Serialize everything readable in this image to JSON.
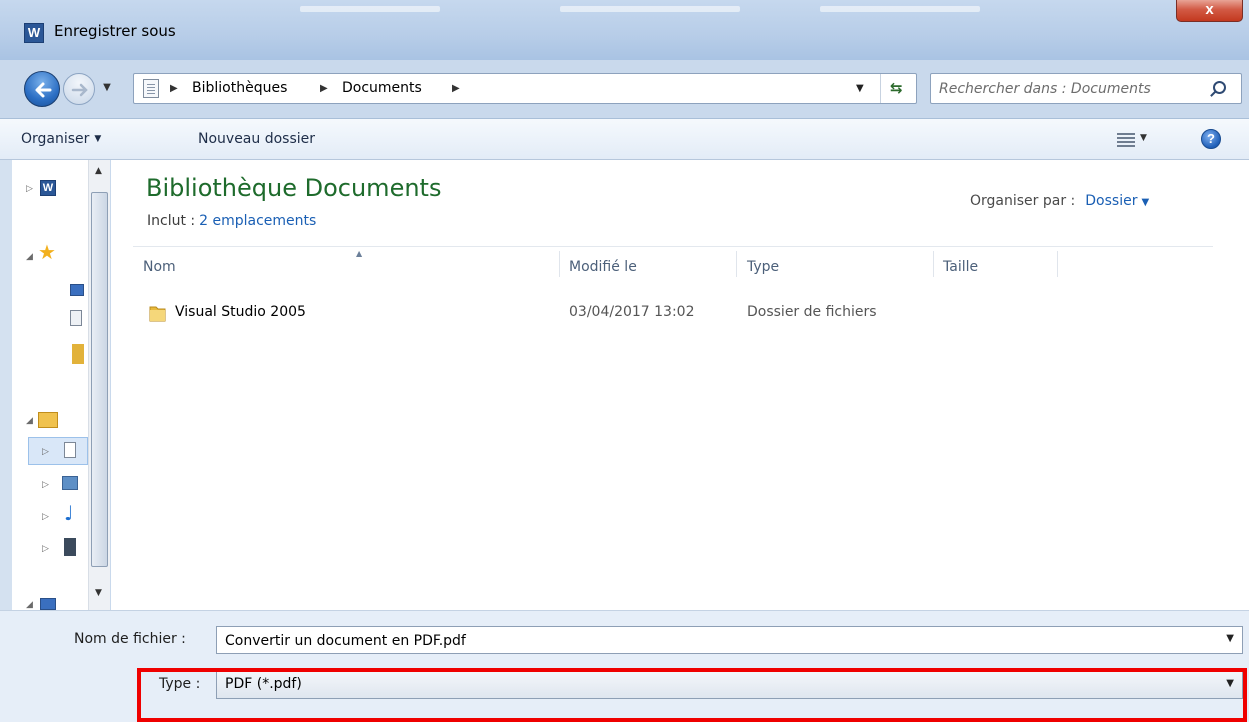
{
  "window": {
    "title": "Enregistrer sous",
    "close_glyph": "x",
    "app_logo_letter": "W"
  },
  "nav": {
    "breadcrumbs": [
      "Bibliothèques",
      "Documents"
    ],
    "refresh_glyph": "⇆",
    "search_placeholder": "Rechercher dans : Documents"
  },
  "toolbar": {
    "organize_label": "Organiser",
    "new_folder_label": "Nouveau dossier",
    "help_glyph": "?"
  },
  "library": {
    "title": "Bibliothèque Documents",
    "includes_label": "Inclut :",
    "includes_link": "2 emplacements",
    "arrange_label": "Organiser par :",
    "arrange_value": "Dossier"
  },
  "columns": {
    "name": "Nom",
    "modified": "Modifié le",
    "type": "Type",
    "size": "Taille"
  },
  "files": [
    {
      "name": "Visual Studio 2005",
      "modified": "03/04/2017 13:02",
      "type": "Dossier de fichiers",
      "size": ""
    }
  ],
  "form": {
    "filename_label": "Nom de fichier :",
    "filename_value": "Convertir un document en PDF.pdf",
    "type_label": "Type :",
    "type_value": "PDF (*.pdf)"
  },
  "colors": {
    "library_title": "#1e6b2c",
    "link": "#1a5fb4",
    "highlight": "#ef0000"
  },
  "icons": [
    "word-logo-icon",
    "back-arrow-icon",
    "forward-arrow-icon",
    "library-icon",
    "refresh-icon",
    "search-icon",
    "view-options-icon",
    "help-icon",
    "folder-icon",
    "star-icon",
    "computer-icon"
  ]
}
